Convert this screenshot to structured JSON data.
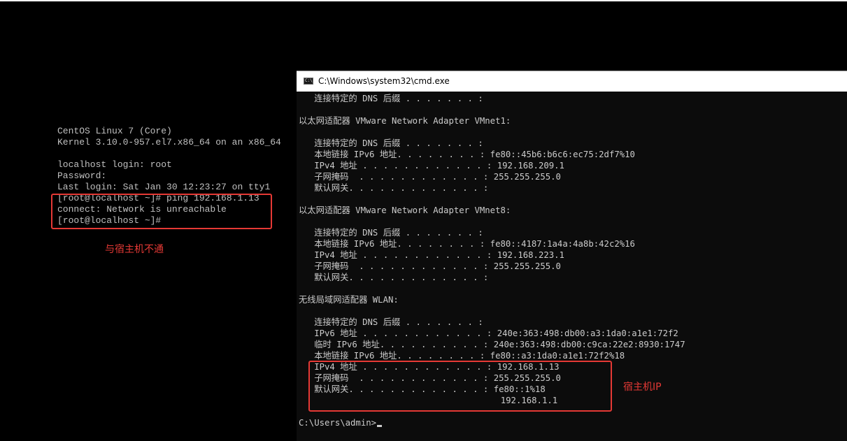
{
  "linux_console": {
    "lines": [
      "CentOS Linux 7 (Core)",
      "Kernel 3.10.0-957.el7.x86_64 on an x86_64",
      "",
      "localhost login: root",
      "Password:",
      "Last login: Sat Jan 30 12:23:27 on tty1",
      "[root@localhost ~]# ping 192.168.1.13",
      "connect: Network is unreachable",
      "[root@localhost ~]#"
    ],
    "annotation": "与宿主机不通"
  },
  "cmd_window": {
    "title": "C:\\Windows\\system32\\cmd.exe",
    "icon_label": "C:\\",
    "lines": [
      "   连接特定的 DNS 后缀 . . . . . . . :",
      "",
      "以太网适配器 VMware Network Adapter VMnet1:",
      "",
      "   连接特定的 DNS 后缀 . . . . . . . :",
      "   本地链接 IPv6 地址. . . . . . . . : fe80::45b6:b6c6:ec75:2df7%10",
      "   IPv4 地址 . . . . . . . . . . . . : 192.168.209.1",
      "   子网掩码  . . . . . . . . . . . . : 255.255.255.0",
      "   默认网关. . . . . . . . . . . . . :",
      "",
      "以太网适配器 VMware Network Adapter VMnet8:",
      "",
      "   连接特定的 DNS 后缀 . . . . . . . :",
      "   本地链接 IPv6 地址. . . . . . . . : fe80::4187:1a4a:4a8b:42c2%16",
      "   IPv4 地址 . . . . . . . . . . . . : 192.168.223.1",
      "   子网掩码  . . . . . . . . . . . . : 255.255.255.0",
      "   默认网关. . . . . . . . . . . . . :",
      "",
      "无线局域网适配器 WLAN:",
      "",
      "   连接特定的 DNS 后缀 . . . . . . . :",
      "   IPv6 地址 . . . . . . . . . . . . : 240e:363:498:db00:a3:1da0:a1e1:72f2",
      "   临时 IPv6 地址. . . . . . . . . . : 240e:363:498:db00:c9ca:22e2:8930:1747",
      "   本地链接 IPv6 地址. . . . . . . . : fe80::a3:1da0:a1e1:72f2%18",
      "   IPv4 地址 . . . . . . . . . . . . : 192.168.1.13",
      "   子网掩码  . . . . . . . . . . . . : 255.255.255.0",
      "   默认网关. . . . . . . . . . . . . : fe80::1%18",
      "                                       192.168.1.1",
      "",
      "C:\\Users\\admin>"
    ],
    "annotation": "宿主机IP"
  },
  "colors": {
    "annotation": "#e53935",
    "console_text": "#c0c0c0",
    "cmd_text": "#cccccc",
    "cmd_bg": "#0c0c0c"
  }
}
